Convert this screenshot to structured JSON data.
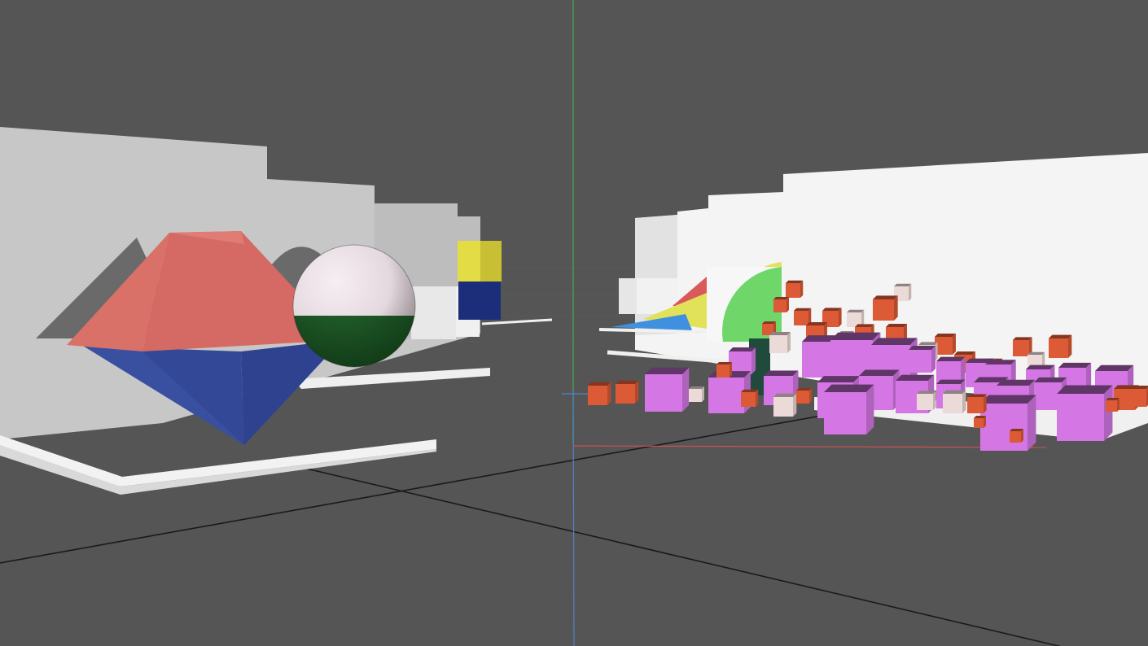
{
  "scene": {
    "kind": "3d-viewport",
    "background_color": "#555555",
    "grid_color": "#5c5c5c",
    "axes": {
      "x_color": "#d05050",
      "y_color": "#3fae55",
      "z_color": "#4e84c8",
      "ground_line_color": "#1a1a1a"
    },
    "objects": {
      "octahedron": {
        "top_color": "#d9716a",
        "bottom_color": "#35499a"
      },
      "sphere": {
        "top_color": "#e9dfe6",
        "bottom_color": "#1d5b26"
      },
      "yellow_blue_block": {
        "top_color": "#e4dc45",
        "bottom_color": "#1c2e7a"
      },
      "pie_wedge": {
        "color": "#6fd66a"
      },
      "area_ramps": {
        "colors": [
          "#e2e25a",
          "#d95a5a",
          "#3f91e0"
        ]
      },
      "cubes": {
        "primary_color": "#d477e4",
        "secondary_color": "#dc5a35",
        "tertiary_color": "#ecdad8"
      }
    }
  }
}
